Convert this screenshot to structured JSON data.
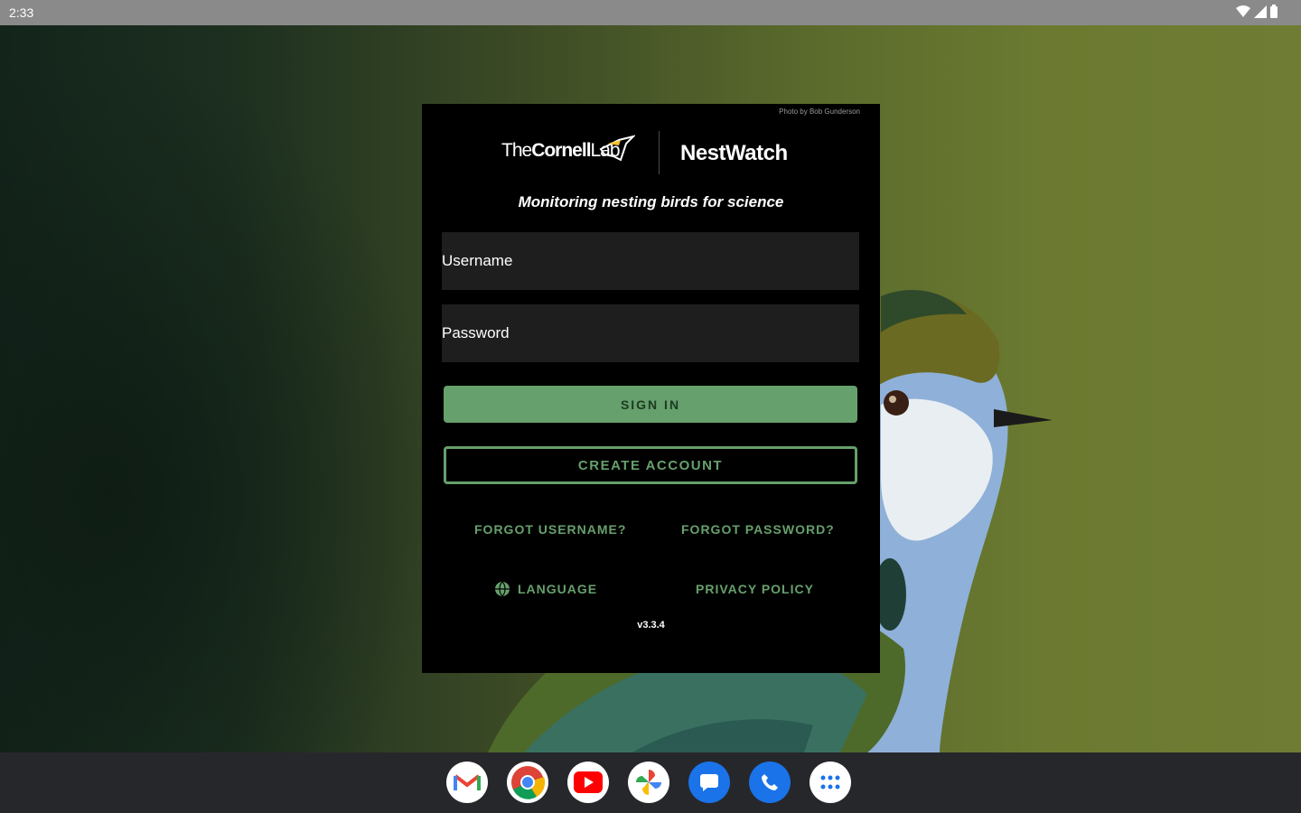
{
  "status_bar": {
    "time": "2:33",
    "icons": [
      "wifi-icon",
      "signal-icon",
      "battery-icon"
    ]
  },
  "card": {
    "photo_credit": "Photo by Bob Gunderson",
    "logos": {
      "cornell_prefix": "The",
      "cornell_bold": "Cornell",
      "cornell_suffix": "Lab",
      "app_name": "NestWatch"
    },
    "tagline": "Monitoring nesting birds for science",
    "username_placeholder": "Username",
    "password_placeholder": "Password",
    "sign_in_label": "SIGN IN",
    "create_account_label": "CREATE ACCOUNT",
    "forgot_username_label": "FORGOT USERNAME?",
    "forgot_password_label": "FORGOT PASSWORD?",
    "language_label": "LANGUAGE",
    "privacy_policy_label": "PRIVACY POLICY",
    "version": "v3.3.4"
  },
  "taskbar": {
    "apps": [
      "gmail-icon",
      "chrome-icon",
      "youtube-icon",
      "photos-icon",
      "messages-icon",
      "phone-icon",
      "app-drawer-icon"
    ]
  },
  "colors": {
    "accent_green": "#66a06c",
    "card_bg": "#000000",
    "field_bg": "#1e1e1e",
    "taskbar_bg": "#26272b"
  }
}
